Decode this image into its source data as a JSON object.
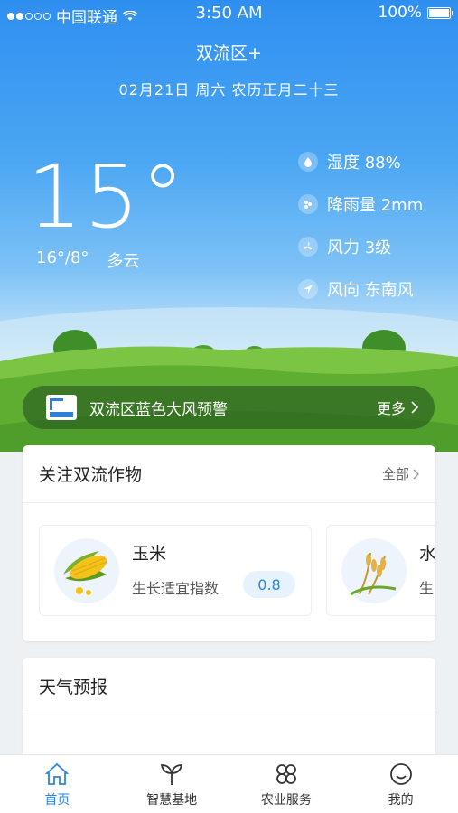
{
  "status_bar": {
    "carrier": "中国联通",
    "time": "3:50 AM",
    "battery": "100%"
  },
  "header": {
    "location": "双流区+",
    "date": "02月21日 周六 农历正月二十三"
  },
  "current": {
    "temperature": "15°",
    "range": "16°/8°",
    "condition": "多云"
  },
  "metrics": [
    {
      "icon": "humidity-icon",
      "label": "湿度 88%"
    },
    {
      "icon": "rain-icon",
      "label": "降雨量 2mm"
    },
    {
      "icon": "wind-icon",
      "label": "风力 3级"
    },
    {
      "icon": "wind-direction-icon",
      "label": "风向 东南风"
    }
  ],
  "alert": {
    "text": "双流区蓝色大风预警",
    "more": "更多"
  },
  "crops_card": {
    "title": "关注双流作物",
    "link": "全部",
    "items": [
      {
        "name": "玉米",
        "index_label": "生长适宜指数",
        "value": "0.8",
        "image": "corn"
      },
      {
        "name": "水",
        "index_label": "生",
        "image": "rice"
      }
    ]
  },
  "forecast_card": {
    "title": "天气预报"
  },
  "tabs": [
    {
      "label": "首页",
      "icon": "home-icon",
      "active": true
    },
    {
      "label": "智慧基地",
      "icon": "sprout-icon",
      "active": false
    },
    {
      "label": "农业服务",
      "icon": "clover-icon",
      "active": false
    },
    {
      "label": "我的",
      "icon": "smile-icon",
      "active": false
    }
  ],
  "colors": {
    "accent": "#2d85e0",
    "sky": "#2f8ff0",
    "grass": "#6fbf3a"
  }
}
